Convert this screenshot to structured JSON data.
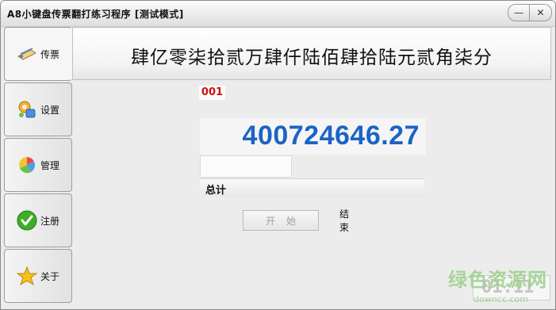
{
  "window": {
    "title": "A8小键盘传票翻打练习程序 [测试模式]",
    "controls": [
      "—",
      "✕"
    ]
  },
  "sidebar": {
    "items": [
      {
        "label": "传票",
        "icon": "ticket-icon",
        "active": true
      },
      {
        "label": "设置",
        "icon": "settings-icon",
        "active": false
      },
      {
        "label": "管理",
        "icon": "manage-icon",
        "active": false
      },
      {
        "label": "注册",
        "icon": "checkmark-icon",
        "active": false
      },
      {
        "label": "关于",
        "icon": "star-icon",
        "active": false
      }
    ]
  },
  "main": {
    "amount_in_words": "肆亿零柒拾贰万肆仟陆佰肆拾陆元贰角柒分",
    "ticket_number": "001",
    "amount": "400724646.27",
    "input_value": "",
    "total_label": "总计",
    "start_label": "开始",
    "end_label": "结束",
    "clock": "01:11"
  },
  "watermark": {
    "text": "绿色资源网",
    "url": "downcc.com"
  },
  "colors": {
    "amount": "#1c64c4",
    "ticket_number": "#d01010"
  }
}
